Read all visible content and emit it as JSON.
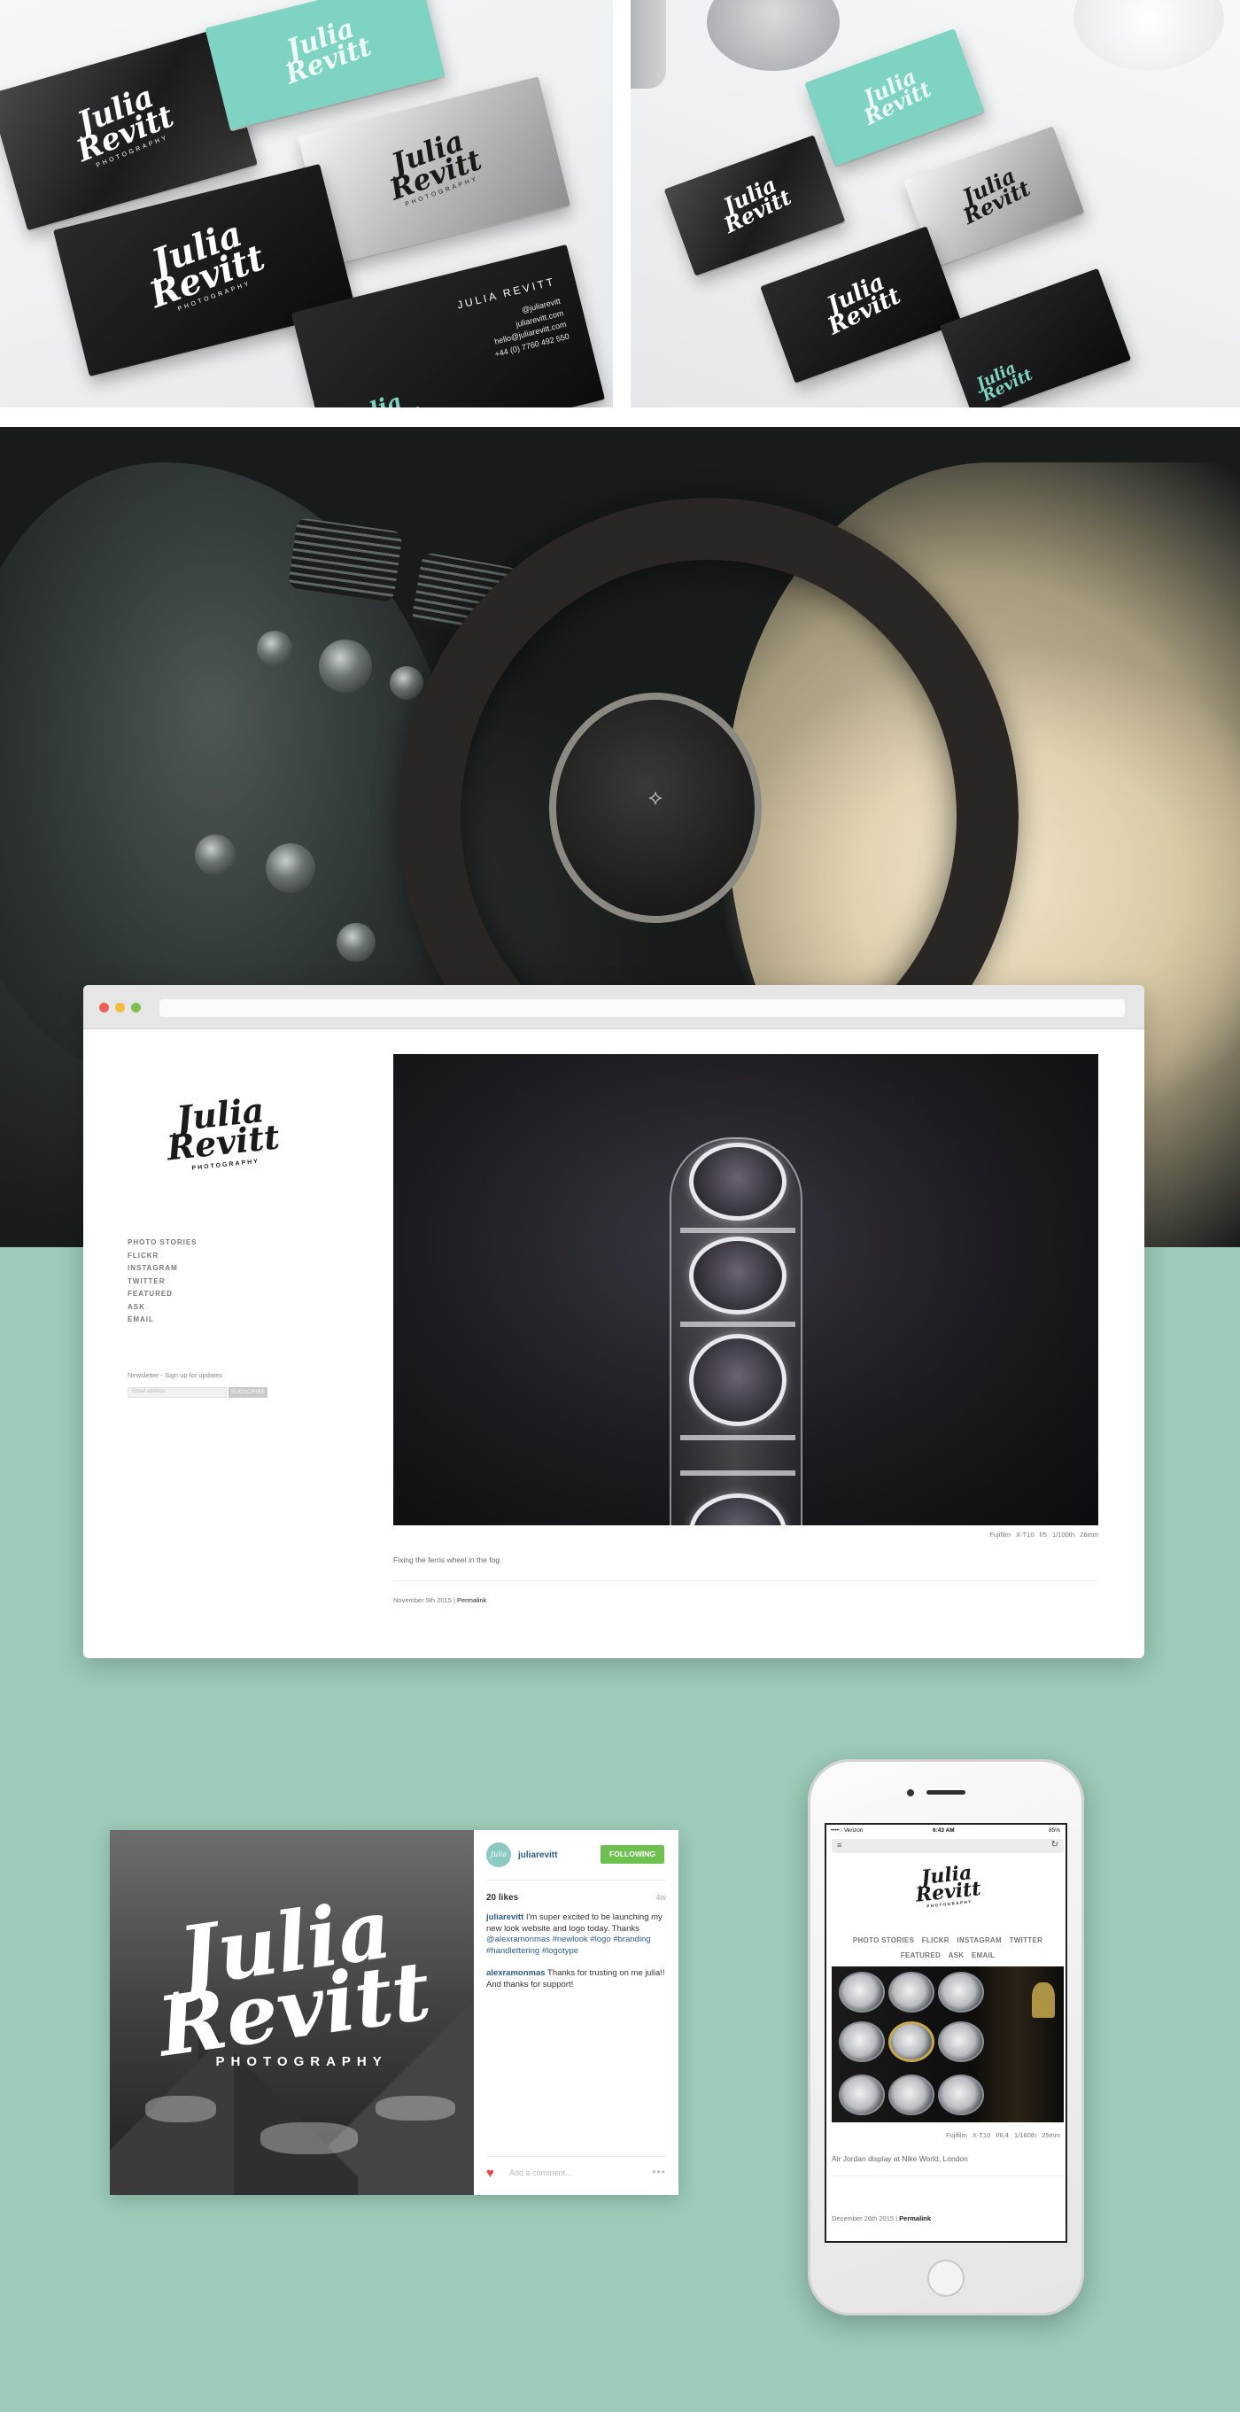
{
  "cards": {
    "logo_line1": "Julia",
    "logo_line2": "Revitt",
    "logo_sub": "PHOTOGRAPHY",
    "contact_name": "JULIA REVITT",
    "contact_handle": "@juliarevitt",
    "contact_site": "juliarevitt.com",
    "contact_email": "hello@juliarevitt.com",
    "contact_phone": "+44 (0) 7760 492 550"
  },
  "browser": {
    "logo_line1": "Julia",
    "logo_line2": "Revitt",
    "logo_sub": "PHOTOGRAPHY",
    "nav": [
      "PHOTO STORIES",
      "FLICKR",
      "INSTAGRAM",
      "TWITTER",
      "FEATURED",
      "ASK",
      "EMAIL"
    ],
    "newsletter_label": "Newsletter - Sign up for updates",
    "email_placeholder": "Email address",
    "subscribe_label": "SUBSCRIBE",
    "exif": "Fujifilm X-T10   f/5   1/100th   26mm",
    "caption": "Fixing the ferris wheel in the fog.",
    "date": "November 5th 2015",
    "permalink": "Permalink",
    "date_sep": " | "
  },
  "instagram": {
    "logo_line1": "Julia",
    "logo_line2": "Revitt",
    "logo_sub": "PHOTOGRAPHY",
    "avatar_text": "Julia",
    "handle": "juliarevitt",
    "follow_label": "FOLLOWING",
    "likes": "20 likes",
    "ago": "4w",
    "comment1_user": "juliarevitt",
    "comment1_text": " I'm super excited to be launching my new look website and logo today. Thanks ",
    "comment1_tags": "@alexramonmas #newlook #logo #branding #handlettering #logotype",
    "comment2_user": "alexramonmas",
    "comment2_text": " Thanks for trusting on me julia!! And thanks for support!",
    "add_comment": "Add a comment...",
    "more": "•••"
  },
  "phone": {
    "carrier": "••••○ Verizon",
    "time": "6:43 AM",
    "battery": "85%",
    "logo_line1": "Julia",
    "logo_line2": "Revitt",
    "logo_sub": "PHOTOGRAPHY",
    "nav_row1": [
      "PHOTO STORIES",
      "FLICKR",
      "INSTAGRAM",
      "TWITTER"
    ],
    "nav_row2": [
      "FEATURED",
      "ASK",
      "EMAIL"
    ],
    "exif": "Fujifilm X-T10   f/6.4   1/160th   25mm",
    "caption": "Air Jordan display at Nike World, London",
    "date": "December 26th 2015",
    "date_sep": " | ",
    "permalink": "Permalink"
  },
  "icons": {
    "menu": "≡",
    "reload": "↻",
    "heart": "♥"
  },
  "colors": {
    "mint": "#9ccbb8",
    "card_mint": "#7fd3c3",
    "follow_green": "#70c050",
    "link_blue": "#2c5d86",
    "heart_red": "#e4484d"
  }
}
